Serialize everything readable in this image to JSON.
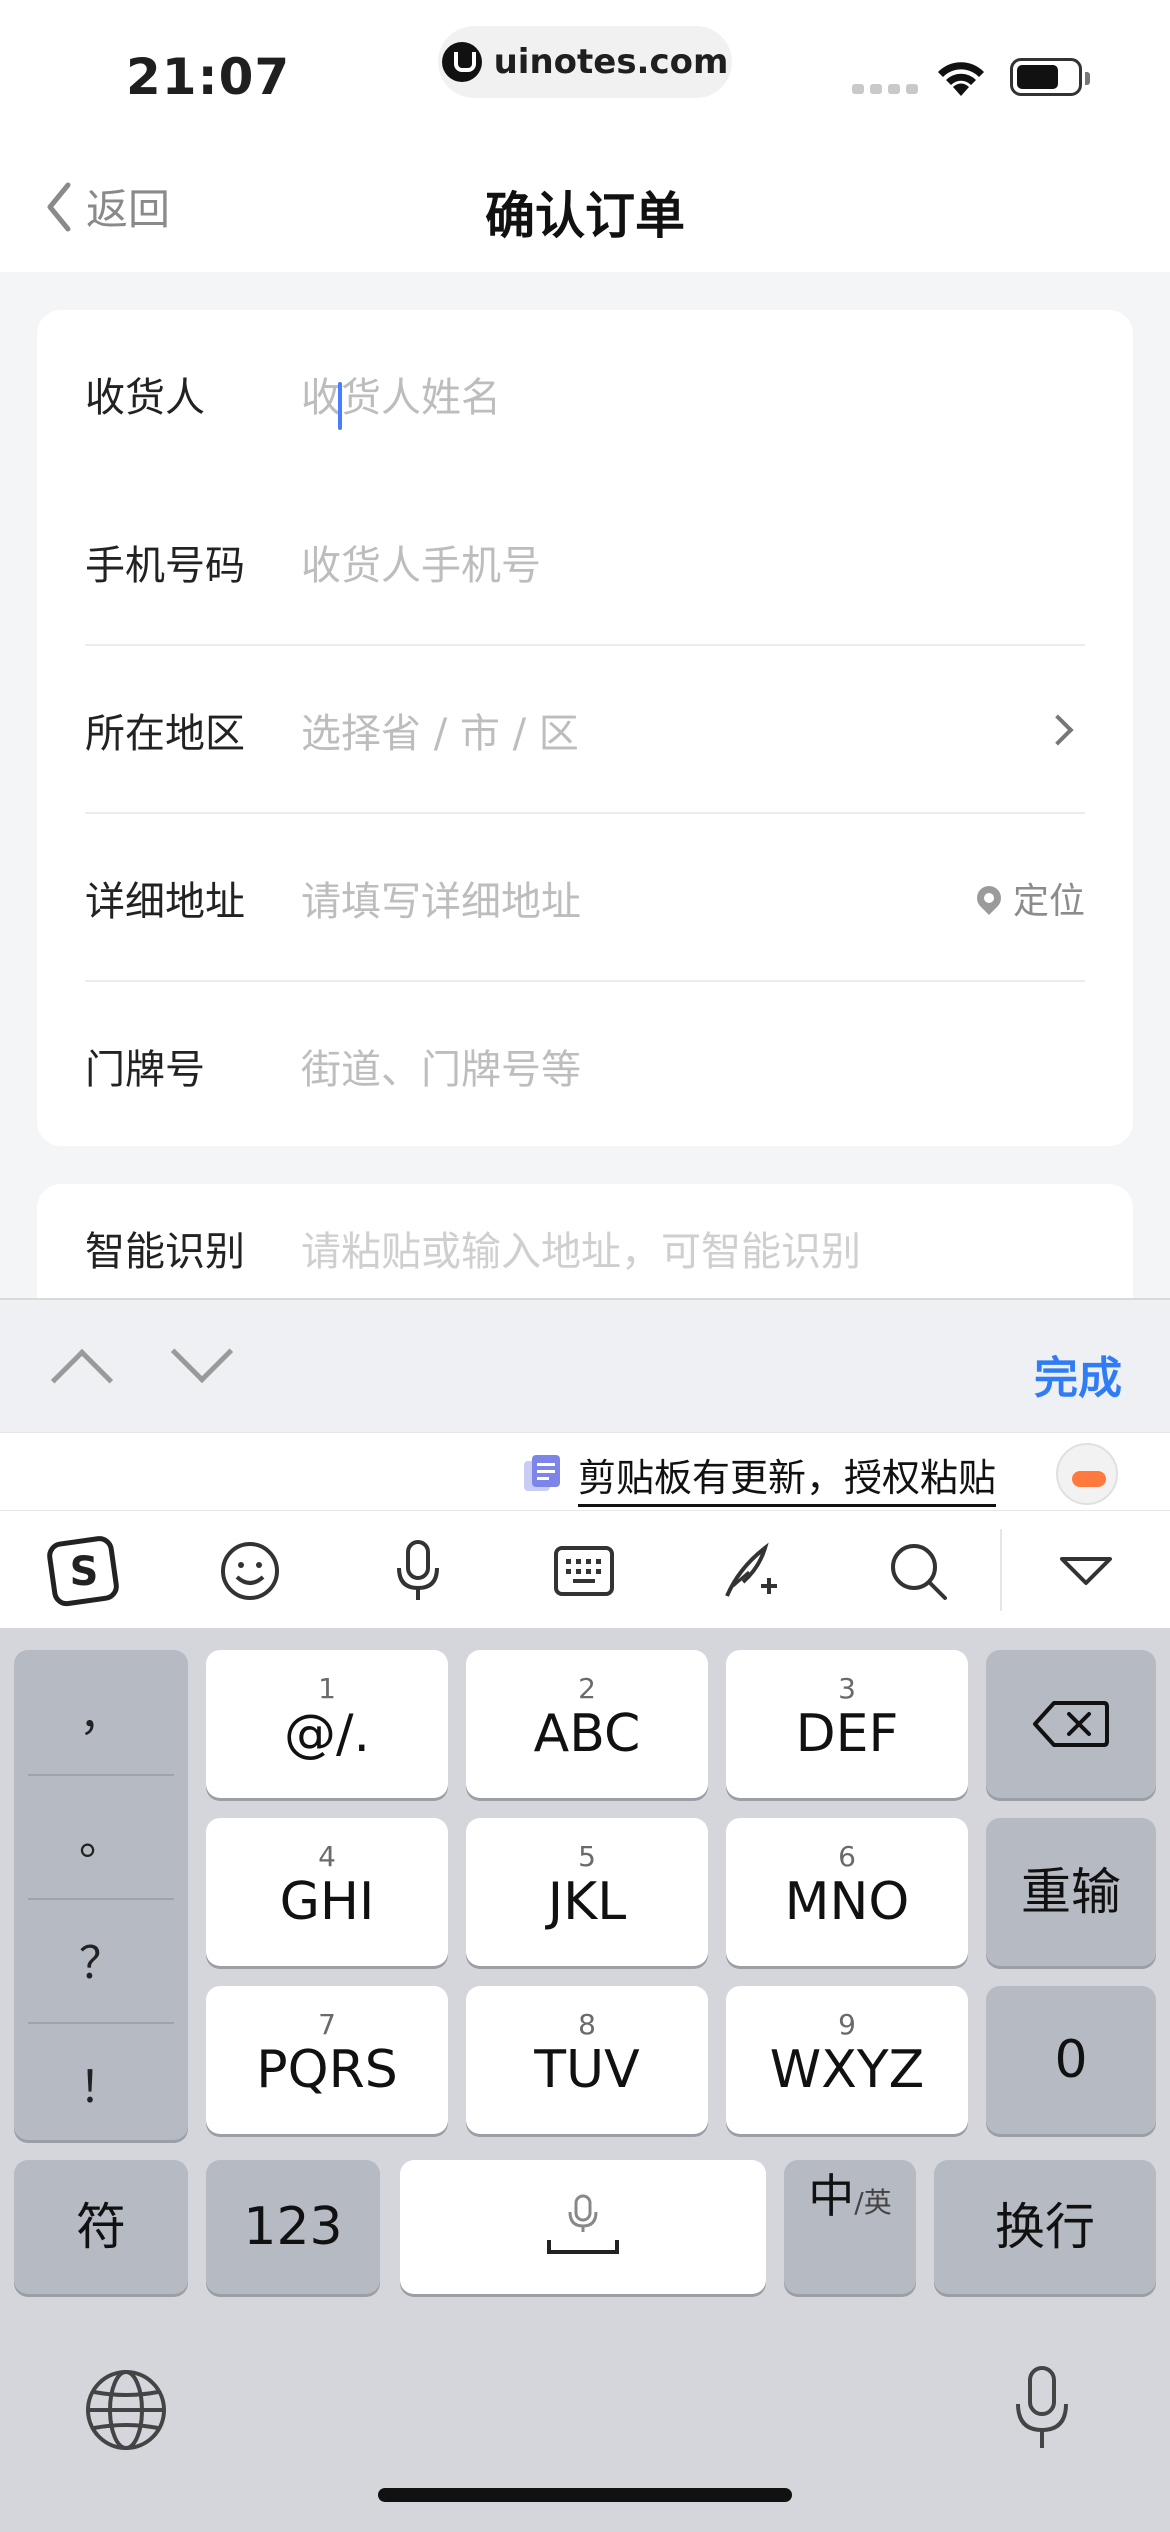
{
  "status": {
    "time": "21:07",
    "url": "uinotes.com"
  },
  "nav": {
    "back_label": "返回",
    "title": "确认订单"
  },
  "form": {
    "rows": [
      {
        "label": "收货人",
        "placeholder": "收货人姓名"
      },
      {
        "label": "手机号码",
        "placeholder": "收货人手机号"
      },
      {
        "label": "所在地区",
        "placeholder": "选择省 / 市 / 区"
      },
      {
        "label": "详细地址",
        "placeholder": "请填写详细地址",
        "action": "定位"
      },
      {
        "label": "门牌号",
        "placeholder": "街道、门牌号等"
      }
    ],
    "smart": {
      "label": "智能识别",
      "placeholder": "请粘贴或输入地址，可智能识别"
    }
  },
  "accessory": {
    "done_label": "完成"
  },
  "clipboard": {
    "text": "剪贴板有更新，授权粘贴"
  },
  "toolbar": {
    "icons": [
      "sogou-logo-icon",
      "emoji-icon",
      "microphone-icon",
      "keyboard-icon",
      "handwriting-icon",
      "search-icon",
      "collapse-icon"
    ]
  },
  "keyboard": {
    "punct": [
      "，",
      "。",
      "？",
      "！"
    ],
    "keys": [
      {
        "num": "1",
        "main": "@/."
      },
      {
        "num": "2",
        "main": "ABC"
      },
      {
        "num": "3",
        "main": "DEF"
      },
      {
        "num": "4",
        "main": "GHI"
      },
      {
        "num": "5",
        "main": "JKL"
      },
      {
        "num": "6",
        "main": "MNO"
      },
      {
        "num": "7",
        "main": "PQRS"
      },
      {
        "num": "8",
        "main": "TUV"
      },
      {
        "num": "9",
        "main": "WXYZ"
      }
    ],
    "reset": "重输",
    "zero": "0",
    "symbols": "符",
    "numbers": "123",
    "lang_main": "中",
    "lang_sub": "/英",
    "enter": "换行"
  },
  "colors": {
    "accent": "#2f7cf6",
    "placeholder": "#bdbdbd",
    "caret": "#4a7cff"
  }
}
